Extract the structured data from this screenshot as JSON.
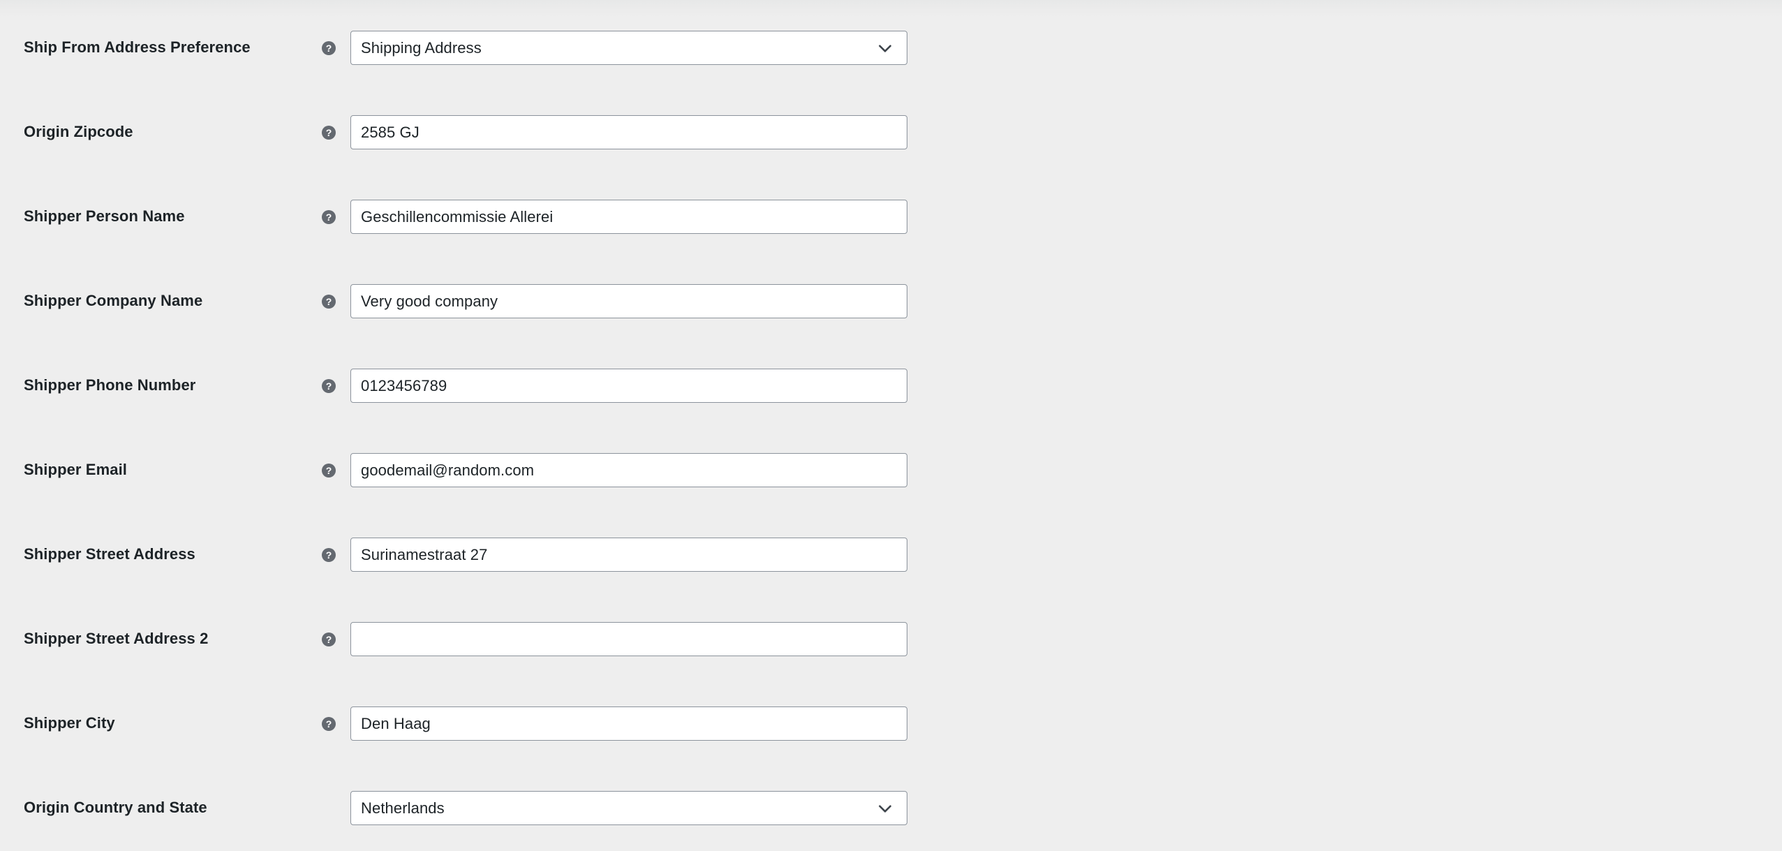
{
  "page": {
    "background_color": "#eeeeee",
    "label_color": "#1d2327",
    "field_border_color": "#8c939c",
    "field_background_color": "#ffffff",
    "help_icon_color": "#646970",
    "chevron_color": "#3c434a"
  },
  "form": {
    "rows": [
      {
        "label": "Ship From Address Preference",
        "help": "?",
        "has_help": true,
        "control": "select",
        "value": "Shipping Address",
        "name": "ship-from-address-preference"
      },
      {
        "label": "Origin Zipcode",
        "help": "?",
        "has_help": true,
        "control": "text",
        "value": "2585 GJ",
        "name": "origin-zipcode"
      },
      {
        "label": "Shipper Person Name",
        "help": "?",
        "has_help": true,
        "control": "text",
        "value": "Geschillencommissie Allerei",
        "name": "shipper-person-name"
      },
      {
        "label": "Shipper Company Name",
        "help": "?",
        "has_help": true,
        "control": "text",
        "value": "Very good company",
        "name": "shipper-company-name"
      },
      {
        "label": "Shipper Phone Number",
        "help": "?",
        "has_help": true,
        "control": "text",
        "value": "0123456789",
        "name": "shipper-phone-number"
      },
      {
        "label": "Shipper Email",
        "help": "?",
        "has_help": true,
        "control": "text",
        "value": "goodemail@random.com",
        "name": "shipper-email"
      },
      {
        "label": "Shipper Street Address",
        "help": "?",
        "has_help": true,
        "control": "text",
        "value": "Surinamestraat 27",
        "name": "shipper-street-address"
      },
      {
        "label": "Shipper Street Address 2",
        "help": "?",
        "has_help": true,
        "control": "text",
        "value": "",
        "name": "shipper-street-address-2"
      },
      {
        "label": "Shipper City",
        "help": "?",
        "has_help": true,
        "control": "text",
        "value": "Den Haag",
        "name": "shipper-city"
      },
      {
        "label": "Origin Country and State",
        "help": "",
        "has_help": false,
        "control": "select",
        "value": "Netherlands",
        "name": "origin-country-and-state"
      }
    ]
  }
}
